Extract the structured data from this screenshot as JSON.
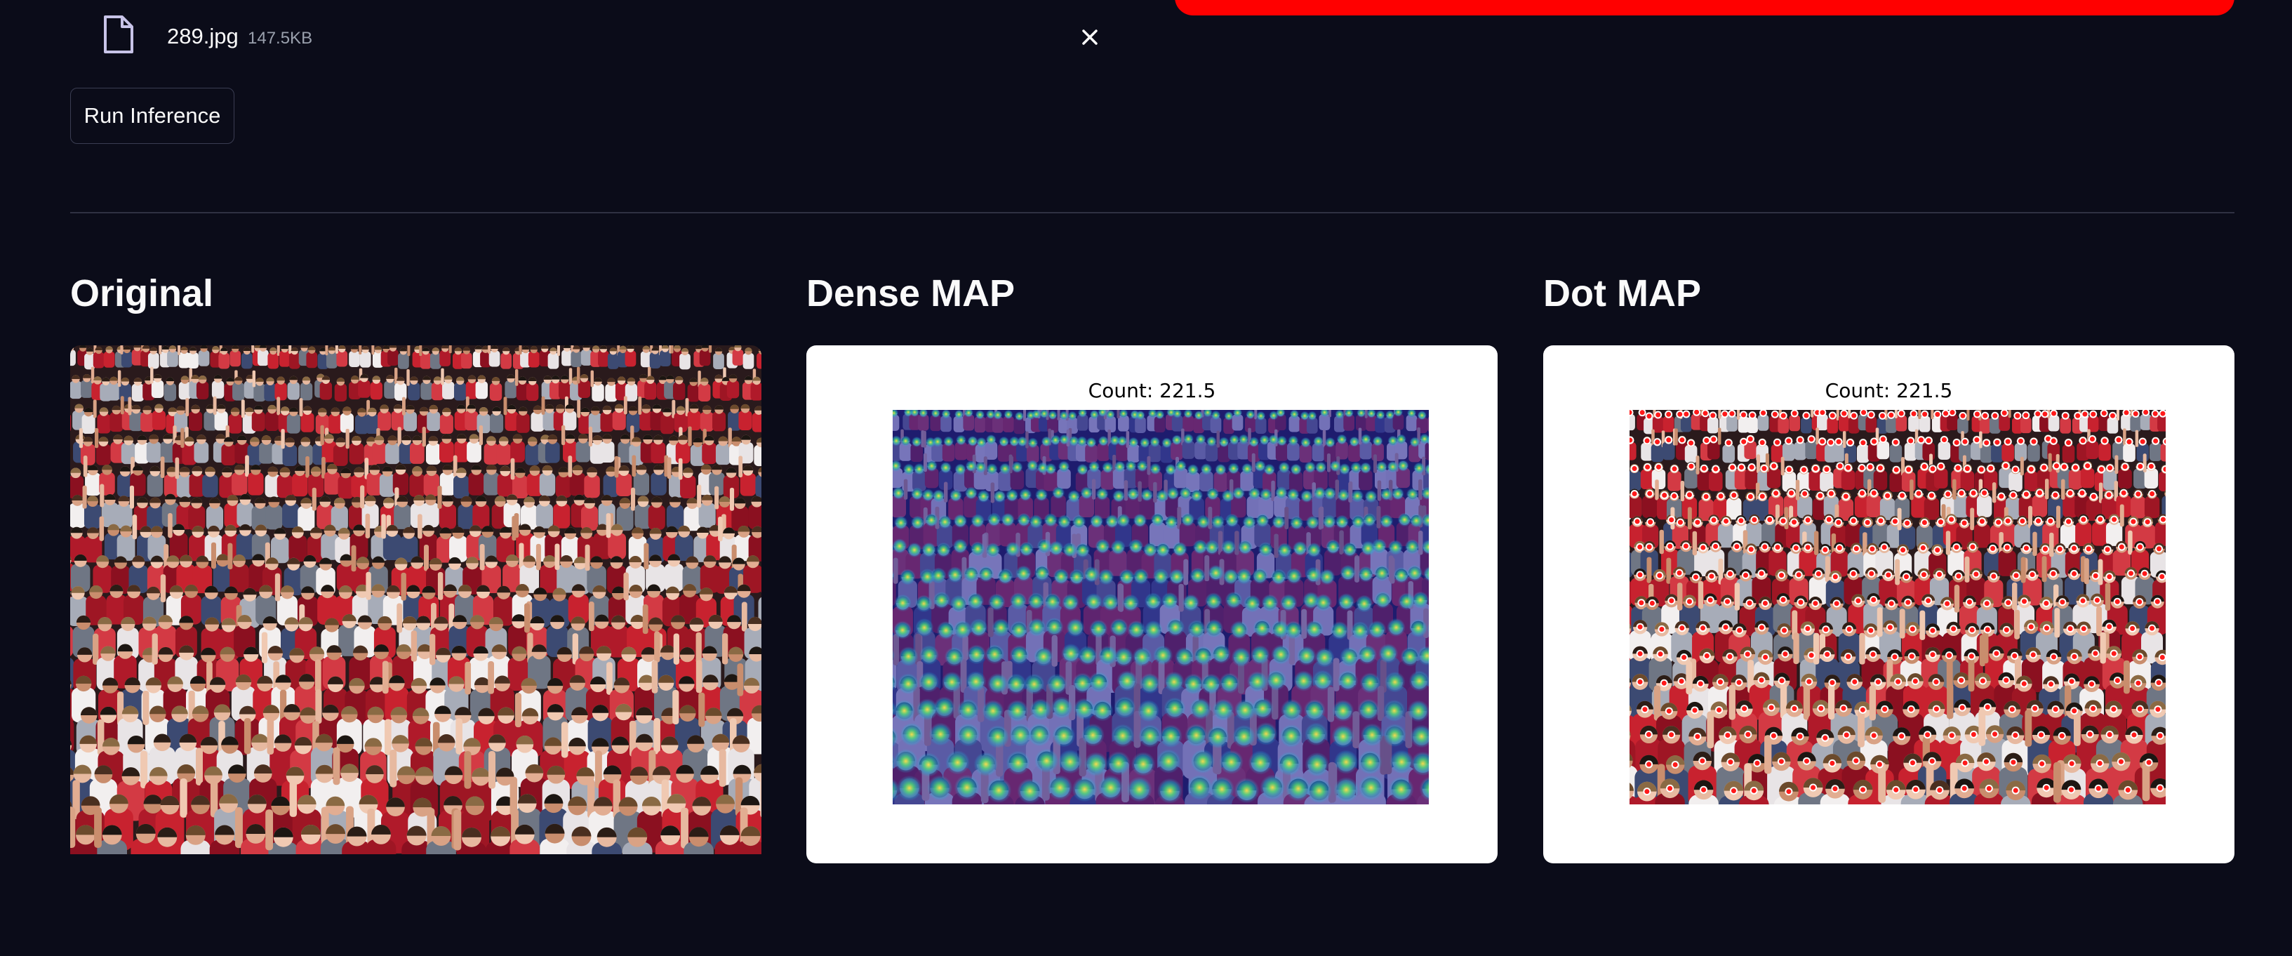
{
  "upload": {
    "file_name": "289.jpg",
    "file_size": "147.5KB",
    "file_icon": "file-icon",
    "remove_icon": "close-icon"
  },
  "actions": {
    "run_label": "Run Inference"
  },
  "columns": [
    {
      "title": "Original"
    },
    {
      "title": "Dense MAP",
      "count_label": "Count: 221.5"
    },
    {
      "title": "Dot MAP",
      "count_label": "Count: 221.5"
    }
  ],
  "colors": {
    "background": "#0b0c19",
    "accent_bar": "#ff0000",
    "crowd_red": "#b01a2a",
    "heatmap_base": "#2b2a9a",
    "dot_marker": "#ff1a1a"
  }
}
